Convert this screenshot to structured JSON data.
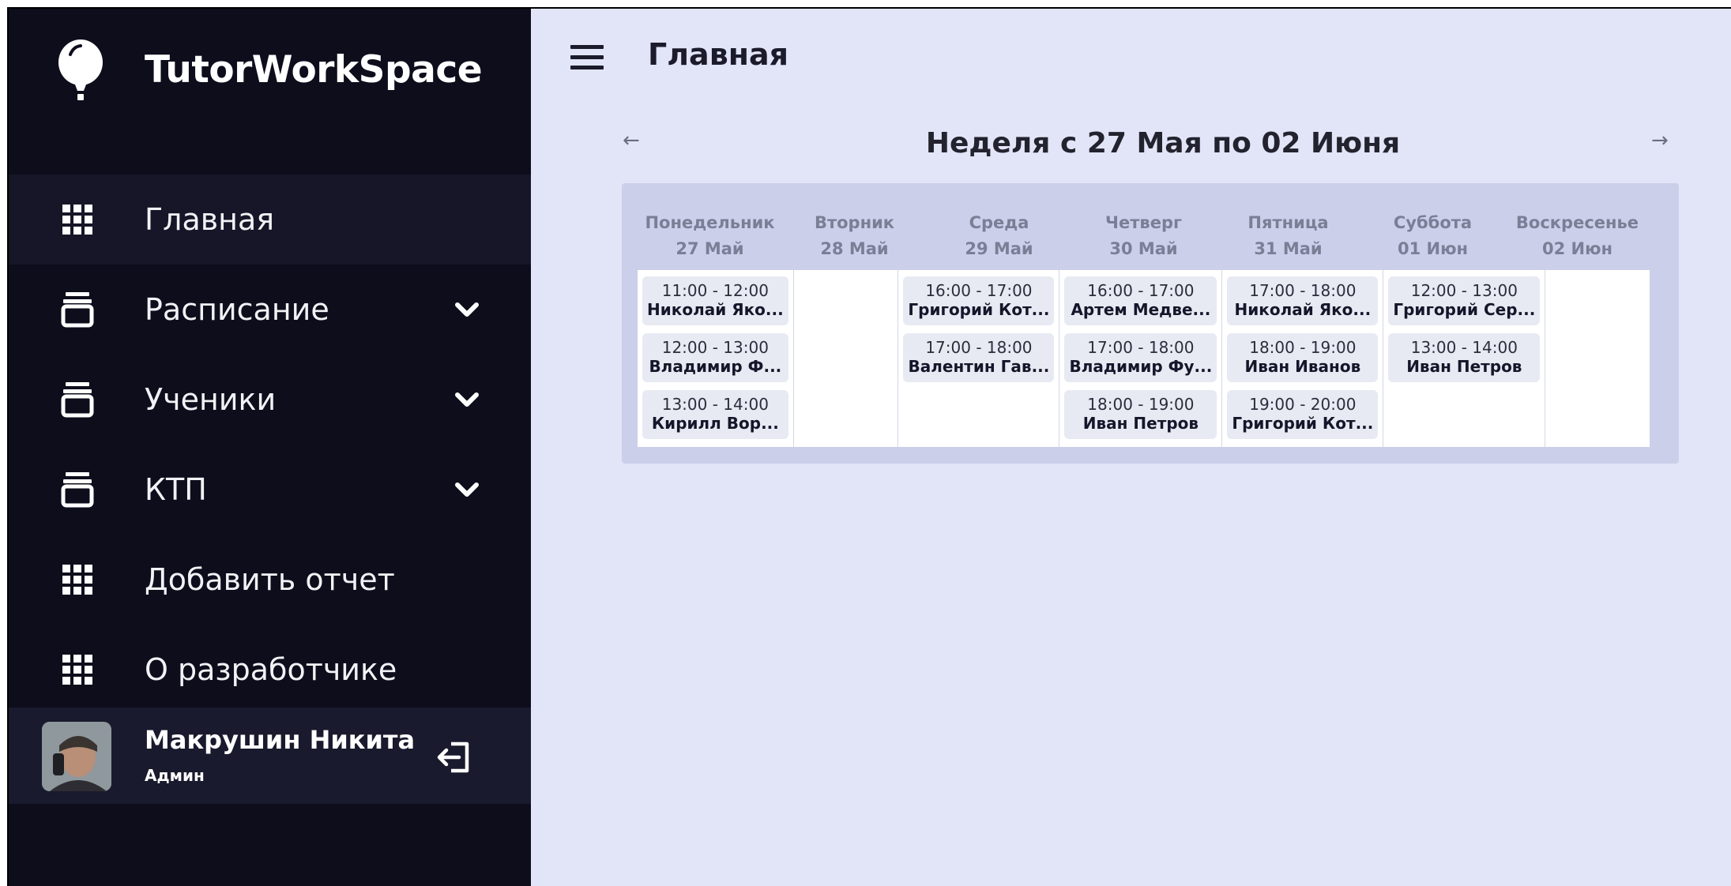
{
  "app": {
    "name": "TutorWorkSpace",
    "logo_icon": "balloon-icon"
  },
  "sidebar": {
    "items": [
      {
        "label": "Главная",
        "icon": "grid-icon",
        "active": true,
        "expandable": false
      },
      {
        "label": "Расписание",
        "icon": "stack-icon",
        "active": false,
        "expandable": true
      },
      {
        "label": "Ученики",
        "icon": "stack-icon",
        "active": false,
        "expandable": true
      },
      {
        "label": "КТП",
        "icon": "stack-icon",
        "active": false,
        "expandable": true
      },
      {
        "label": "Добавить отчет",
        "icon": "grid-icon",
        "active": false,
        "expandable": false
      },
      {
        "label": "О разработчике",
        "icon": "grid-icon",
        "active": false,
        "expandable": false
      }
    ]
  },
  "user": {
    "name": "Макрушин Никита",
    "role": "Админ"
  },
  "header": {
    "title": "Главная"
  },
  "week": {
    "title": "Неделя с 27 Мая по 02 Июня",
    "prev": "←",
    "next": "→"
  },
  "days": [
    {
      "name": "Понедельник",
      "date": "27 Май",
      "lessons": [
        {
          "time": "11:00 - 12:00",
          "student": "Николай Яко..."
        },
        {
          "time": "12:00 - 13:00",
          "student": "Владимир Ф..."
        },
        {
          "time": "13:00 - 14:00",
          "student": "Кирилл Вор..."
        }
      ]
    },
    {
      "name": "Вторник",
      "date": "28 Май",
      "lessons": []
    },
    {
      "name": "Среда",
      "date": "29 Май",
      "lessons": [
        {
          "time": "16:00 - 17:00",
          "student": "Григорий Кот..."
        },
        {
          "time": "17:00 - 18:00",
          "student": "Валентин Гав..."
        }
      ]
    },
    {
      "name": "Четверг",
      "date": "30 Май",
      "lessons": [
        {
          "time": "16:00 - 17:00",
          "student": "Артем Медве..."
        },
        {
          "time": "17:00 - 18:00",
          "student": "Владимир Фу..."
        },
        {
          "time": "18:00 - 19:00",
          "student": "Иван Петров"
        }
      ]
    },
    {
      "name": "Пятница",
      "date": "31 Май",
      "lessons": [
        {
          "time": "17:00 - 18:00",
          "student": "Николай Яко..."
        },
        {
          "time": "18:00 - 19:00",
          "student": "Иван Иванов"
        },
        {
          "time": "19:00 - 20:00",
          "student": "Григорий Кот..."
        }
      ]
    },
    {
      "name": "Суббота",
      "date": "01 Июн",
      "lessons": [
        {
          "time": "12:00 - 13:00",
          "student": "Григорий Сер..."
        },
        {
          "time": "13:00 - 14:00",
          "student": "Иван Петров"
        }
      ]
    },
    {
      "name": "Воскресенье",
      "date": "02 Июн",
      "lessons": []
    }
  ],
  "colors": {
    "sidebar_bg": "#0d0d1c",
    "active_item_bg": "#171628",
    "main_bg": "#e1e5f7",
    "calendar_frame": "#cbcfea",
    "lesson_bg": "#e8eaf3"
  }
}
